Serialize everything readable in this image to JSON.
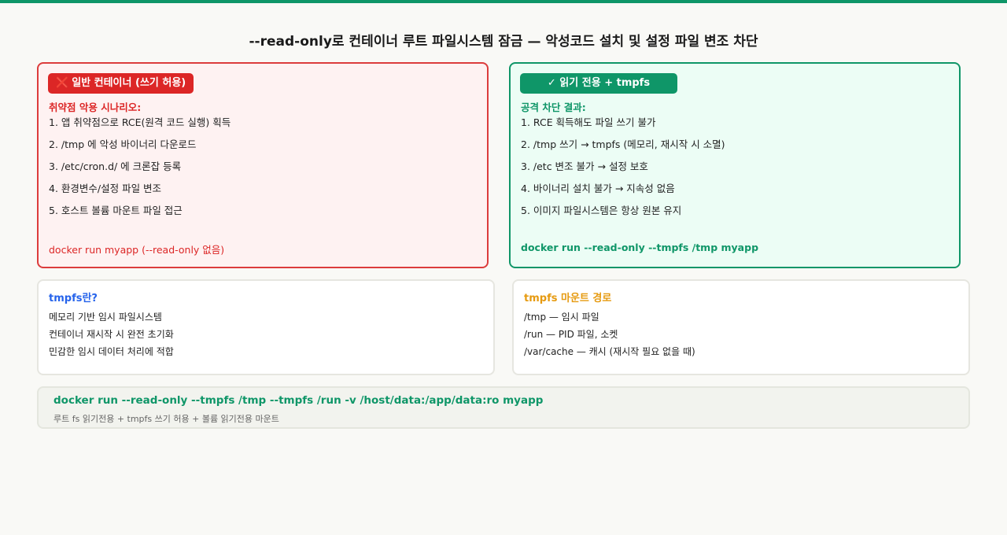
{
  "title": "--read-only로 컨테이너 루트 파일시스템 잠금 — 악성코드 설치 및 설정 파일 변조 차단",
  "colors": {
    "accent": "#0f9668",
    "danger": "#dc2626",
    "info_blue": "#2563eb",
    "info_orange": "#e69a10"
  },
  "bad_panel": {
    "badge_icon": "cross-mark-icon",
    "badge_icon_glyph": "❌",
    "badge": "일반 컨테이너 (쓰기 허용)",
    "subtitle": "취약점 악용 시나리오:",
    "items": [
      "1. 앱 취약점으로 RCE(원격 코드 실행) 획득",
      "2. /tmp 에 악성 바이너리 다운로드",
      "3. /etc/cron.d/ 에 크론잡 등록",
      "4. 환경변수/설정 파일 변조",
      "5. 호스트 볼륨 마운트 파일 접근"
    ],
    "command": "docker run myapp (--read-only 없음)"
  },
  "good_panel": {
    "badge": "✓ 읽기 전용 + tmpfs",
    "subtitle": "공격 차단 결과:",
    "items": [
      "1. RCE 획득해도 파일 쓰기 불가",
      "2. /tmp 쓰기 → tmpfs (메모리, 재시작 시 소멸)",
      "3. /etc 변조 불가 → 설정 보호",
      "4. 바이너리 설치 불가 → 지속성 없음",
      "5. 이미지 파일시스템은 항상 원본 유지"
    ],
    "command": "docker run --read-only --tmpfs /tmp myapp"
  },
  "tmpfs_info": {
    "title": "tmpfs란?",
    "items": [
      "메모리 기반 임시 파일시스템",
      "컨테이너 재시작 시 완전 초기화",
      "민감한 임시 데이터 처리에 적합"
    ]
  },
  "mount_info": {
    "title": "tmpfs 마운트 경로",
    "items": [
      "/tmp — 임시 파일",
      "/run — PID 파일, 소켓",
      "/var/cache — 캐시 (재시작 필요 없을 때)"
    ]
  },
  "final_command": {
    "command": "docker run --read-only --tmpfs /tmp --tmpfs /run -v /host/data:/app/data:ro myapp",
    "description": "루트 fs 읽기전용 + tmpfs 쓰기 허용 + 볼륨 읽기전용 마운트"
  }
}
